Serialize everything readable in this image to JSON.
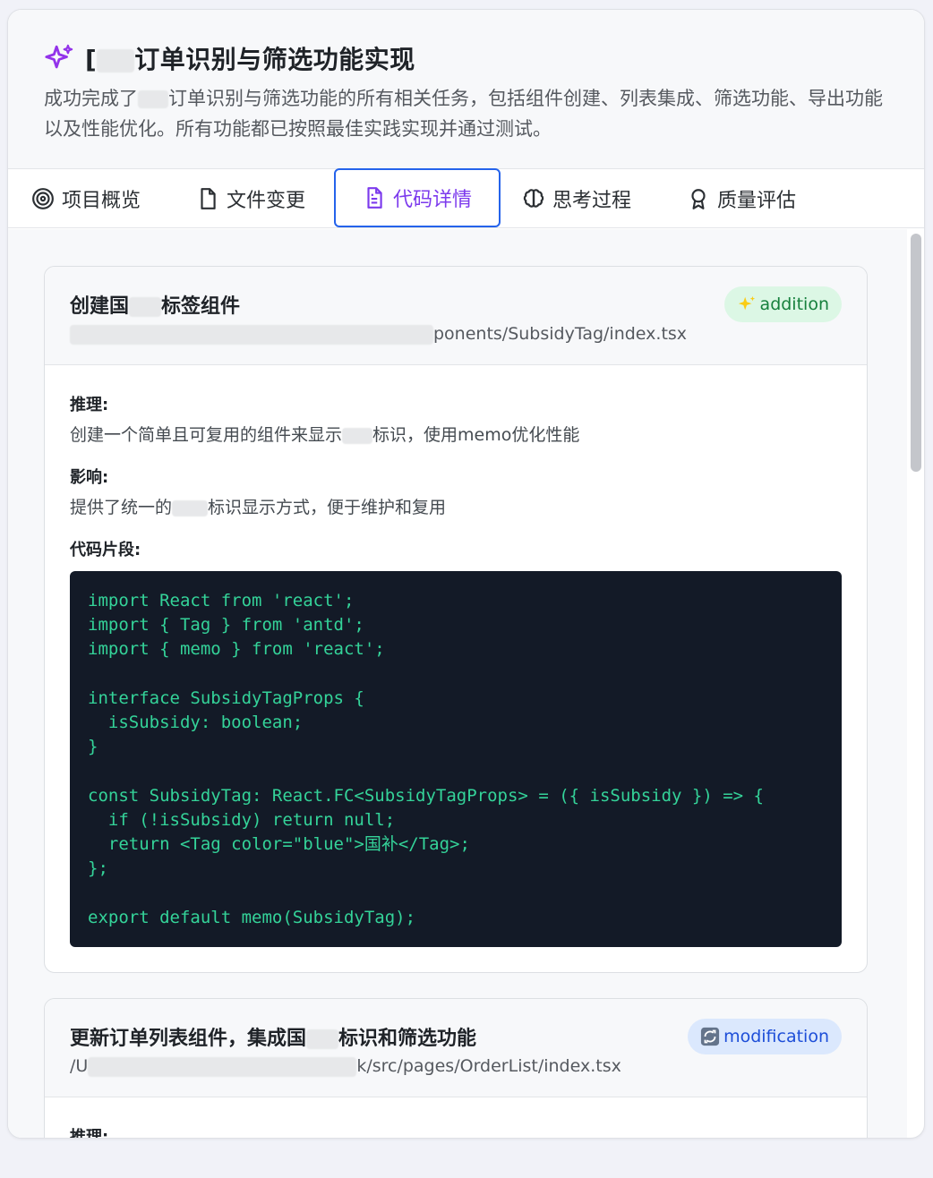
{
  "header": {
    "title_prefix": "[",
    "title_suffix": "订单识别与筛选功能实现",
    "description_prefix": "成功完成了",
    "description_suffix": "订单识别与筛选功能的所有相关任务，包括组件创建、列表集成、筛选功能、导出功能以及性能优化。所有功能都已按照最佳实践实现并通过测试。"
  },
  "tabs": [
    {
      "label": "项目概览",
      "icon": "target-icon"
    },
    {
      "label": "文件变更",
      "icon": "file-icon"
    },
    {
      "label": "代码详情",
      "icon": "file-text-icon",
      "active": true
    },
    {
      "label": "思考过程",
      "icon": "brain-icon"
    },
    {
      "label": "质量评估",
      "icon": "award-icon"
    }
  ],
  "cards": [
    {
      "title_prefix": "创建国",
      "title_suffix": "标签组件",
      "path_suffix": "ponents/SubsidyTag/index.tsx",
      "badge": "addition",
      "badge_icon": "sparkles-icon",
      "reasoning_label": "推理:",
      "reasoning_prefix": "创建一个简单且可复用的组件来显示",
      "reasoning_suffix": "标识，使用memo优化性能",
      "impact_label": "影响:",
      "impact_prefix": "提供了统一的",
      "impact_suffix": "标识显示方式，便于维护和复用",
      "snippet_label": "代码片段:",
      "code": "import React from 'react';\nimport { Tag } from 'antd';\nimport { memo } from 'react';\n\ninterface SubsidyTagProps {\n  isSubsidy: boolean;\n}\n\nconst SubsidyTag: React.FC<SubsidyTagProps> = ({ isSubsidy }) => {\n  if (!isSubsidy) return null;\n  return <Tag color=\"blue\">国补</Tag>;\n};\n\nexport default memo(SubsidyTag);"
    },
    {
      "title_prefix": "更新订单列表组件，集成国",
      "title_suffix": "标识和筛选功能",
      "path_prefix": "/U",
      "path_suffix": "k/src/pages/OrderList/index.tsx",
      "badge": "modification",
      "badge_icon": "refresh-icon",
      "reasoning_label": "推理:"
    }
  ],
  "colors": {
    "accent": "#7c3aed",
    "active_tab_border": "#2563eb",
    "code_bg": "#131a27",
    "code_text": "#34d399"
  }
}
